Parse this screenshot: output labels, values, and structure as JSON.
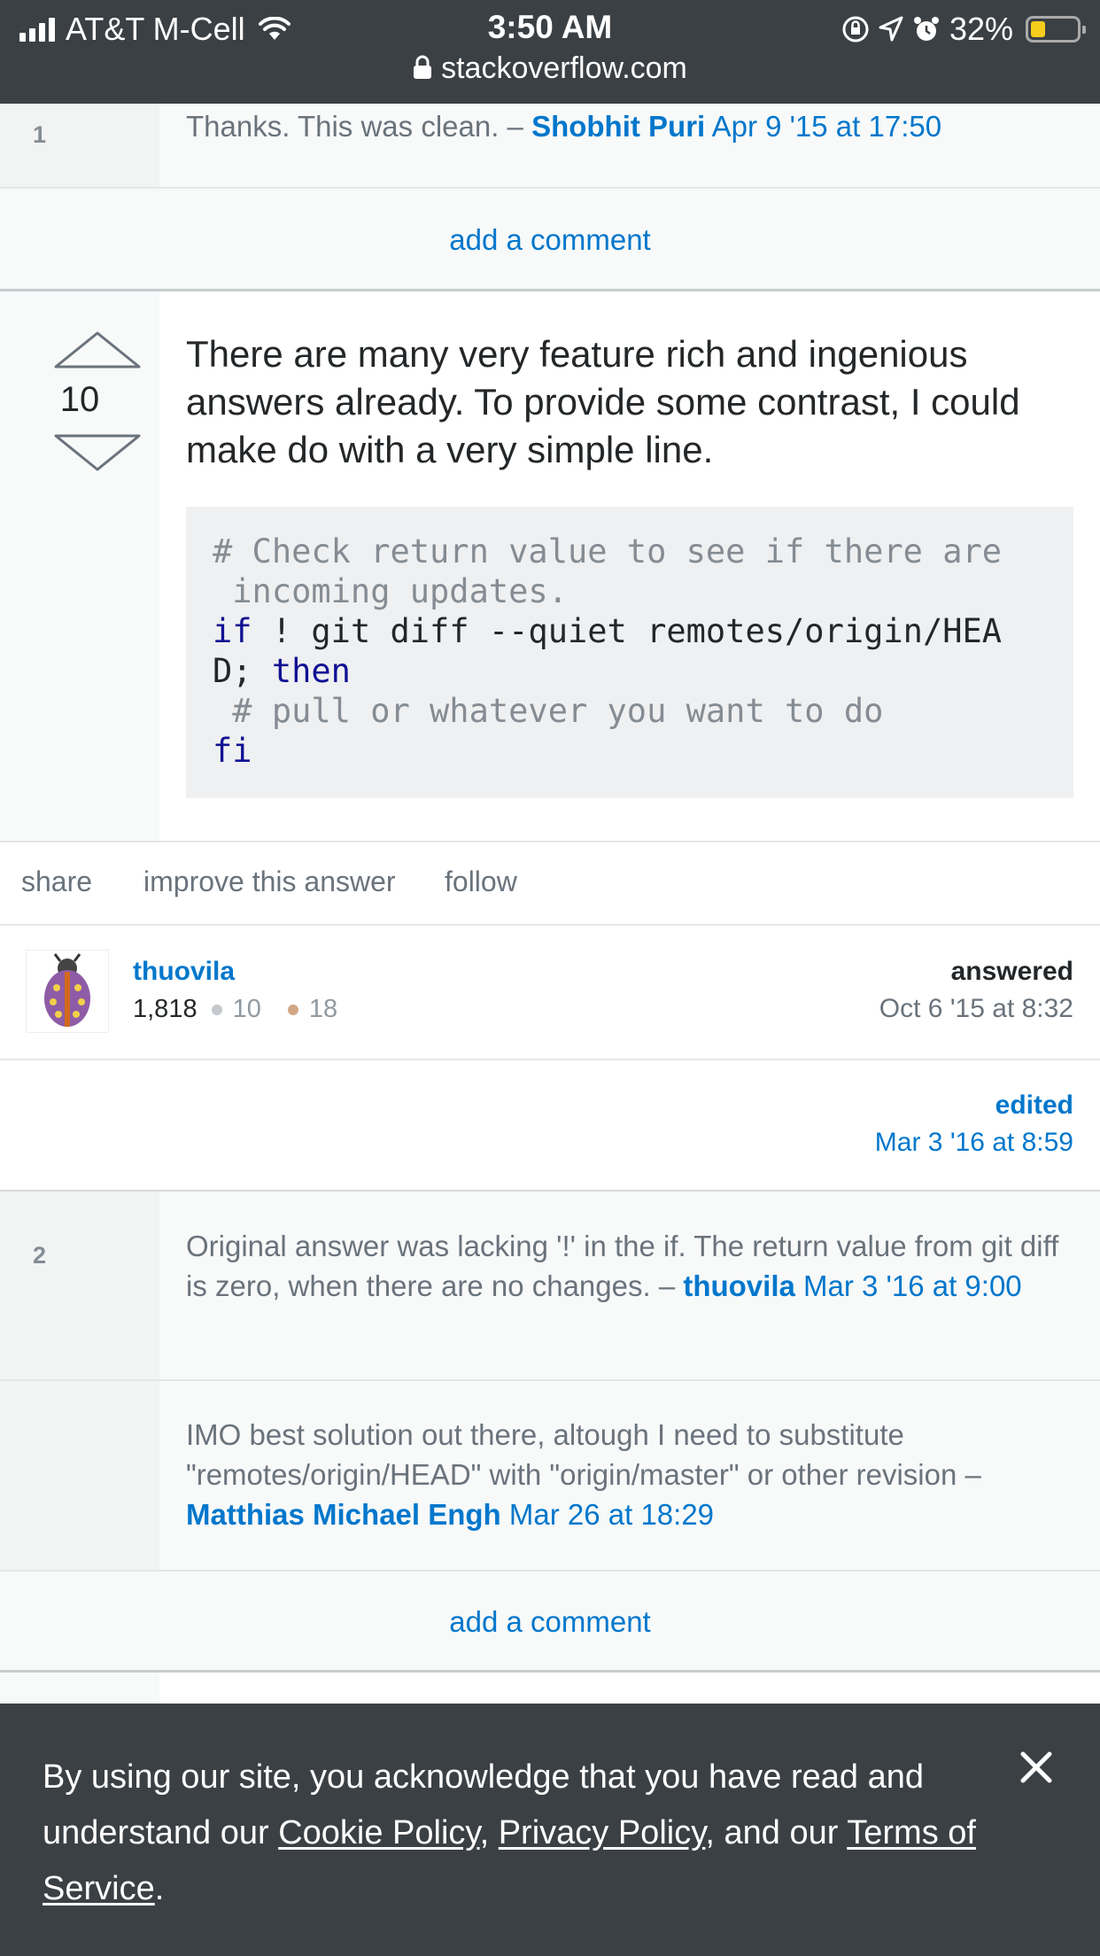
{
  "status_bar": {
    "carrier": "AT&T M-Cell",
    "time": "3:50 AM",
    "battery": "32%",
    "battery_level": 0.32,
    "url": "stackoverflow.com"
  },
  "comments_top": [
    {
      "score": "1",
      "text": "Thanks. This was clean. – ",
      "author": "Shobhit Puri",
      "date": "Apr 9 '15 at 17:50"
    }
  ],
  "add_comment_label": "add a comment",
  "answer": {
    "votes": "10",
    "text": "There are many very feature rich and ingenious answers already. To provide some contrast, I could make do with a very simple line.",
    "code": {
      "line1": "# Check return value to see if there are",
      "line2": " incoming updates.",
      "line3_kw": "if",
      "line3_rest": " ! git diff --quiet remotes/origin/HEA",
      "line4_a": "D; ",
      "line4_kw": "then",
      "line5": " # pull or whatever you want to do",
      "line6_kw": "fi"
    },
    "actions": {
      "share": "share",
      "improve": "improve this answer",
      "follow": "follow"
    },
    "user": {
      "name": "thuovila",
      "reputation": "1,818",
      "silver": "10",
      "bronze": "18"
    },
    "answered_label": "answered",
    "answered_date": "Oct 6 '15 at 8:32",
    "edited_label": "edited",
    "edited_date": "Mar 3 '16 at 8:59"
  },
  "comments_bottom": [
    {
      "score": "2",
      "text": "Original answer was lacking '!' in the if. The return value from git diff is zero, when there are no changes. – ",
      "author": "thuovila",
      "date": "Mar 3 '16 at 9:00"
    },
    {
      "score": "",
      "text": "IMO best solution out there, altough I need to substitute \"remotes/origin/HEAD\" with \"origin/master\" or other revision – ",
      "author": "Matthias Michael Engh",
      "date": "Mar 26 at 18:29"
    }
  ],
  "cookie_banner": {
    "text_before": "By using our site, you acknowledge that you have read and understand our ",
    "cookie_policy": "Cookie Policy",
    "sep1": ", ",
    "privacy_policy": "Privacy Policy",
    "sep2": ", and our ",
    "terms": "Terms of Service",
    "end": "."
  }
}
